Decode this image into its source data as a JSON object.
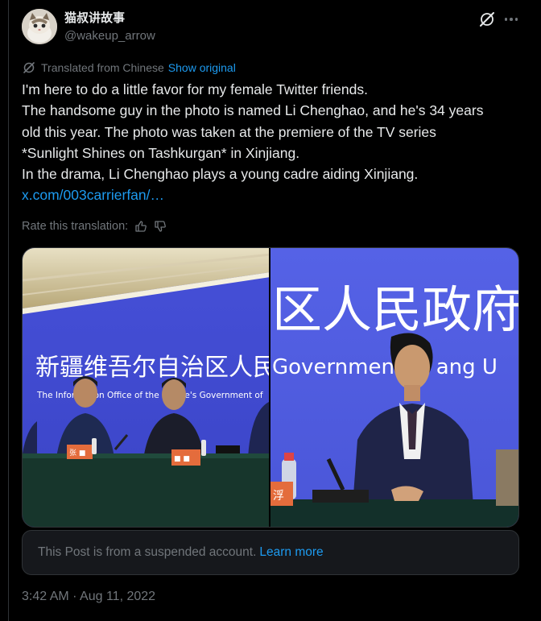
{
  "author": {
    "display_name": "猫叔讲故事",
    "handle": "@wakeup_arrow"
  },
  "icons": {
    "grok": "grok-icon",
    "more": "more-dots-icon",
    "translate": "translate-icon",
    "thumbs_up": "thumbs-up-icon",
    "thumbs_down": "thumbs-down-icon"
  },
  "translation": {
    "label": "Translated from Chinese",
    "show_original": "Show original"
  },
  "tweet": {
    "lines": [
      "I'm here to do a little favor for my female Twitter friends.",
      "The handsome guy in the photo is named Li Chenghao, and he's 34 years",
      "old this year. The photo was taken at the premiere of the TV series",
      "*Sunlight Shines on Tashkurgan* in Xinjiang.",
      "In the drama, Li Chenghao plays a young cadre aiding Xinjiang."
    ],
    "link": "x.com/003carrierfan/…"
  },
  "rating": {
    "label": "Rate this translation:"
  },
  "media": {
    "left_banner": "新疆维吾尔自治区人民",
    "left_banner_en": "The Information Office of the People's Government of",
    "left_nameplates": [
      "张 ■",
      "■ ■",
      "■■■"
    ],
    "right_banner": "区人民政府",
    "right_banner_en": "Government of   ang U",
    "right_nameplate": "浮"
  },
  "notice": {
    "text": "This Post is from a suspended account.",
    "link": "Learn more"
  },
  "timestamp": "3:42 AM · Aug 11, 2022",
  "colors": {
    "background": "#000000",
    "text": "#e7e9ea",
    "muted": "#71767b",
    "accent": "#1d9bf0",
    "border": "#2f3336",
    "notice_bg": "#16181c"
  }
}
